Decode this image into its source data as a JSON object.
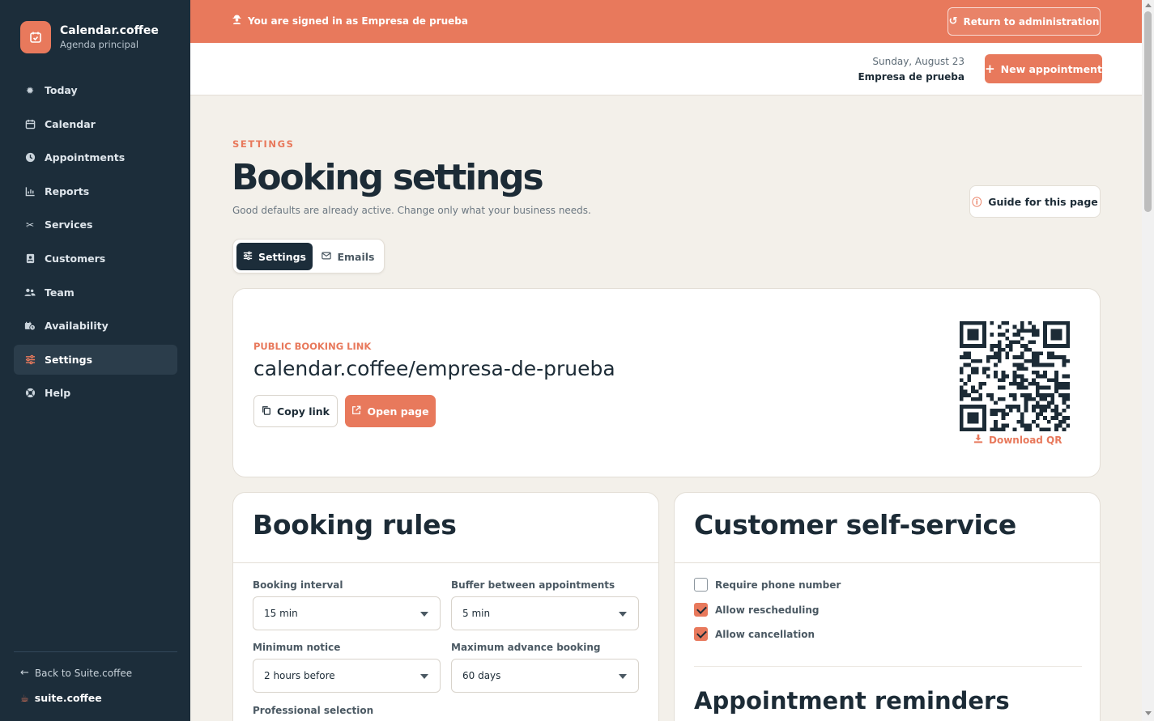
{
  "brand": {
    "title": "Calendar.coffee",
    "subtitle": "Agenda principal"
  },
  "sidebar": {
    "items": [
      {
        "label": "Today",
        "icon": "sun-icon"
      },
      {
        "label": "Calendar",
        "icon": "calendar-icon"
      },
      {
        "label": "Appointments",
        "icon": "clock-icon"
      },
      {
        "label": "Reports",
        "icon": "chart-icon"
      },
      {
        "label": "Services",
        "icon": "scissors-icon"
      },
      {
        "label": "Customers",
        "icon": "contact-icon"
      },
      {
        "label": "Team",
        "icon": "users-icon"
      },
      {
        "label": "Availability",
        "icon": "availability-icon"
      },
      {
        "label": "Settings",
        "icon": "sliders-icon",
        "active": true
      },
      {
        "label": "Help",
        "icon": "lifebuoy-icon"
      }
    ],
    "back_label": "Back to Suite.coffee",
    "suite_label": "suite.coffee"
  },
  "banner": {
    "text": "You are signed in as Empresa de prueba",
    "return_label": "Return to administration"
  },
  "header": {
    "date": "Sunday, August 23",
    "company": "Empresa de prueba",
    "new_label": "New appointment"
  },
  "page": {
    "eyebrow": "SETTINGS",
    "title": "Booking settings",
    "subtitle": "Good defaults are already active. Change only what your business needs.",
    "guide_label": "Guide for this page"
  },
  "tabs": {
    "settings": "Settings",
    "emails": "Emails"
  },
  "public_link": {
    "label": "PUBLIC BOOKING LINK",
    "url": "calendar.coffee/empresa-de-prueba",
    "copy_label": "Copy link",
    "open_label": "Open page",
    "download_label": "Download QR"
  },
  "booking_rules": {
    "title": "Booking rules",
    "interval_label": "Booking interval",
    "interval_value": "15 min",
    "buffer_label": "Buffer between appointments",
    "buffer_value": "5 min",
    "notice_label": "Minimum notice",
    "notice_value": "2 hours before",
    "advance_label": "Maximum advance booking",
    "advance_value": "60 days",
    "professional_label": "Professional selection"
  },
  "self_service": {
    "title": "Customer self-service",
    "require_phone": {
      "label": "Require phone number",
      "checked": false
    },
    "allow_reschedule": {
      "label": "Allow rescheduling",
      "checked": true
    },
    "allow_cancel": {
      "label": "Allow cancellation",
      "checked": true
    },
    "reminders_title": "Appointment reminders"
  },
  "colors": {
    "accent": "#e8795c",
    "sidebar": "#1c2d3a",
    "background": "#f3f0ea"
  }
}
